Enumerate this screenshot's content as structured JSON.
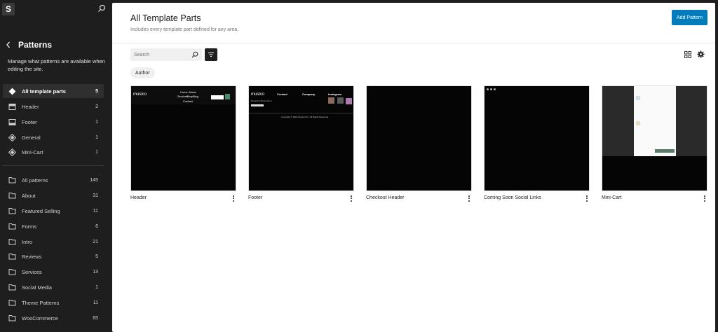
{
  "site": {
    "logo_text": "S"
  },
  "sidebar": {
    "title": "Patterns",
    "description": "Manage what patterns are available when editing the site.",
    "parts": [
      {
        "label": "All template parts",
        "count": "5"
      },
      {
        "label": "Header",
        "count": "2"
      },
      {
        "label": "Footer",
        "count": "1"
      },
      {
        "label": "General",
        "count": "1"
      },
      {
        "label": "Mini-Cart",
        "count": "1"
      }
    ],
    "categories": [
      {
        "label": "All patterns",
        "count": "145"
      },
      {
        "label": "About",
        "count": "31"
      },
      {
        "label": "Featured Selling",
        "count": "11"
      },
      {
        "label": "Forms",
        "count": "6"
      },
      {
        "label": "Intro",
        "count": "21"
      },
      {
        "label": "Reviews",
        "count": "5"
      },
      {
        "label": "Services",
        "count": "13"
      },
      {
        "label": "Social Media",
        "count": "1"
      },
      {
        "label": "Theme Patterns",
        "count": "11"
      },
      {
        "label": "WooCommerce",
        "count": "65"
      }
    ]
  },
  "header": {
    "title": "All Template Parts",
    "subtitle": "Includes every template part defined for any area.",
    "add_label": "Add Pattern"
  },
  "toolbar": {
    "search_placeholder": "Search",
    "author_chip": "Author"
  },
  "cards": [
    {
      "name": "Header"
    },
    {
      "name": "Footer"
    },
    {
      "name": "Checkout Header"
    },
    {
      "name": "Coming Soon Social Links"
    },
    {
      "name": "Mini-Cart"
    }
  ],
  "previews": {
    "header": {
      "logo": "musico",
      "nav": [
        "Home",
        "About",
        "Services",
        "Shop",
        "Blog"
      ],
      "extra": "Contact"
    },
    "footer": {
      "logo": "musico",
      "tagline": "Breathing Music Store",
      "col1_title": "Contact",
      "col2_title": "Company",
      "col3_title": "Instagram",
      "copyright": "Copyright © 2024 Musico Pro. All Rights Reserved."
    }
  },
  "colors": {
    "accent": "#007cba",
    "sidebar_bg": "#1e1e1e",
    "active_bg": "#2f2f2f"
  }
}
